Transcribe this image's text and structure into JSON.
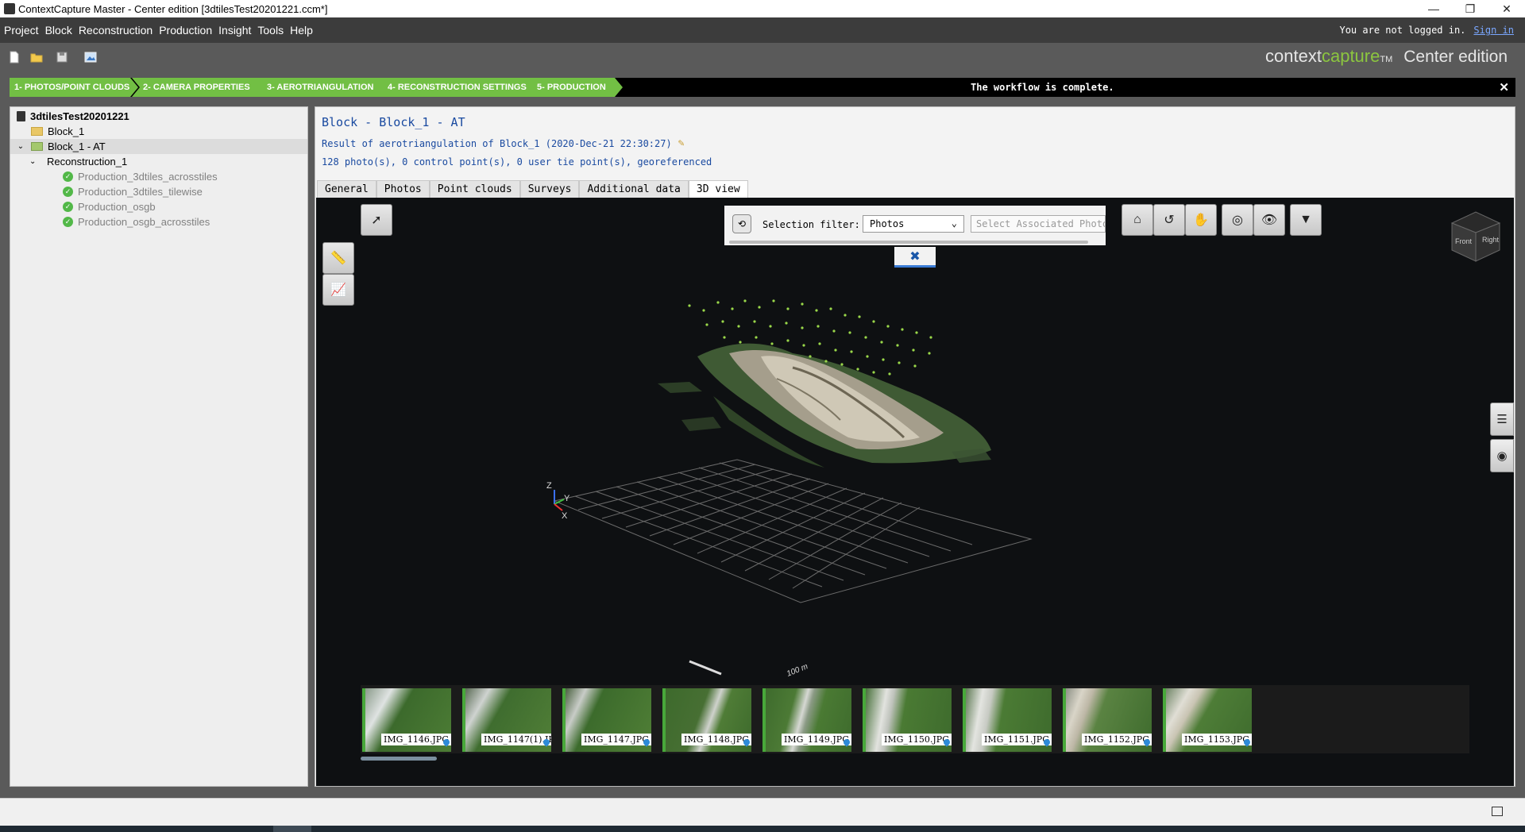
{
  "window": {
    "title": "ContextCapture Master - Center edition [3dtilesTest20201221.ccm*]",
    "controls": [
      "—",
      "❐",
      "✕"
    ]
  },
  "menubar": {
    "items": [
      "Project",
      "Block",
      "Reconstruction",
      "Production",
      "Insight",
      "Tools",
      "Help"
    ],
    "login_text": "You are not logged in.",
    "signin_label": "Sign in"
  },
  "brand": {
    "prefix": "context",
    "highlight": "capture",
    "trademark": "TM",
    "edition": "Center edition",
    "accent_color": "#8cc63f"
  },
  "toolbar": {
    "icons": [
      "new-project-icon",
      "open-folder-icon",
      "save-icon",
      "screenshot-icon"
    ]
  },
  "workflow": {
    "steps": [
      "1- PHOTOS/POINT CLOUDS",
      "2- CAMERA PROPERTIES",
      "3- AEROTRIANGULATION",
      "4- RECONSTRUCTION SETTINGS",
      "5- PRODUCTION"
    ],
    "message": "The workflow is complete.",
    "close": "✕",
    "step_color": "#72bf44"
  },
  "tree": {
    "project": "3dtilesTest20201221",
    "block1": "Block_1",
    "block_at": "Block_1 - AT",
    "reconstruction": "Reconstruction_1",
    "productions": [
      "Production_3dtiles_acrosstiles",
      "Production_3dtiles_tilewise",
      "Production_osgb",
      "Production_osgb_acrosstiles"
    ]
  },
  "block": {
    "title": "Block - Block_1 - AT",
    "result": "Result of aerotriangulation of Block_1 (2020-Dec-21 22:30:27)",
    "summary": "128 photo(s), 0 control point(s), 0 user tie point(s), georeferenced"
  },
  "tabs": [
    "General",
    "Photos",
    "Point clouds",
    "Surveys",
    "Additional data",
    "3D view"
  ],
  "active_tab": "3D view",
  "view3d": {
    "selection_filter_label": "Selection filter:",
    "selection_filter_value": "Photos",
    "associated_placeholder": "Select Associated Photos",
    "scale_label": "100 m",
    "axis_labels": [
      "Z",
      "Y",
      "X"
    ],
    "navcube_faces": [
      "Front",
      "Right"
    ],
    "thumbnails": [
      "IMG_1146.JPG",
      "IMG_1147(1).JPG",
      "IMG_1147.JPG",
      "IMG_1148.JPG",
      "IMG_1149.JPG",
      "IMG_1150.JPG",
      "IMG_1151.JPG",
      "IMG_1152.JPG",
      "IMG_1153.JPG"
    ]
  }
}
